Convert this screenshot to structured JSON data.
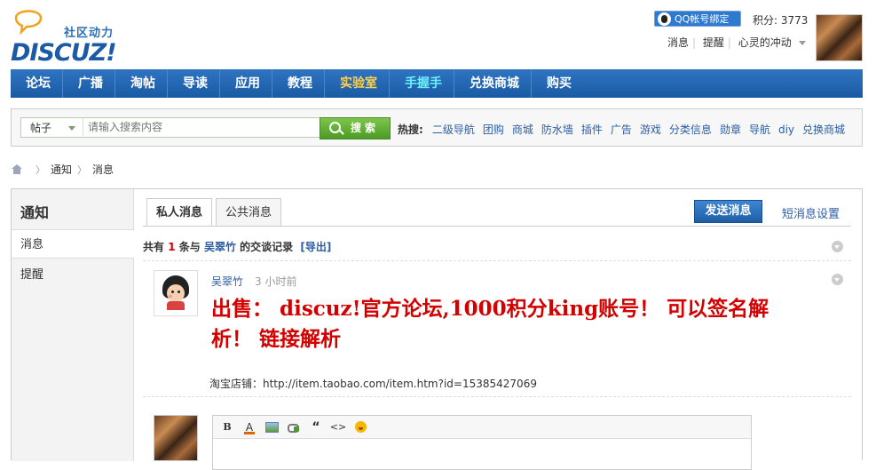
{
  "header": {
    "logo_slogan": "社区动力",
    "logo_word": "DISCUZ!",
    "qq_bind_label": "QQ帐号绑定",
    "score_label": "积分: 3773",
    "user_links": [
      "消息",
      "提醒",
      "心灵的冲动"
    ]
  },
  "nav": {
    "items": [
      {
        "label": "论坛",
        "color": "#ffffff"
      },
      {
        "label": "广播",
        "color": "#ffffff"
      },
      {
        "label": "淘帖",
        "color": "#ffffff"
      },
      {
        "label": "导读",
        "color": "#ffffff"
      },
      {
        "label": "应用",
        "color": "#ffffff"
      },
      {
        "label": "教程",
        "color": "#ffffff"
      },
      {
        "label": "实验室",
        "color": "#ffd24a"
      },
      {
        "label": "手握手",
        "color": "#6ef0ff"
      },
      {
        "label": "兑换商城",
        "color": "#ffffff"
      },
      {
        "label": "购买",
        "color": "#ffffff"
      }
    ]
  },
  "search": {
    "type_label": "帖子",
    "placeholder": "请输入搜索内容",
    "button_label": "搜索",
    "hot_label": "热搜:",
    "hot_terms": [
      "二级导航",
      "团购",
      "商城",
      "防水墙",
      "插件",
      "广告",
      "游戏",
      "分类信息",
      "勋章",
      "导航",
      "diy",
      "兑换商城"
    ]
  },
  "breadcrumb": {
    "items": [
      "通知",
      "消息"
    ]
  },
  "sidebar": {
    "title": "通知",
    "items": [
      "消息",
      "提醒"
    ]
  },
  "tabs": {
    "items": [
      "私人消息",
      "公共消息"
    ]
  },
  "actions": {
    "send_label": "发送消息",
    "settings_label": "短消息设置"
  },
  "summary": {
    "prefix": "共有",
    "count": "1",
    "mid": "条与",
    "user": "吴翠竹",
    "suffix": "的交谈记录",
    "export": "[导出]"
  },
  "message": {
    "author": "吴翠竹",
    "time": "3 小时前",
    "body": "出售： discuz!官方论坛,1000积分king账号！ 可以签名解析！ 链接解析",
    "shop": "淘宝店铺：http://item.taobao.com/item.htm?id=15385427069"
  },
  "editor": {
    "toolbar": [
      "bold-icon",
      "font-color-icon",
      "image-icon",
      "link-icon",
      "quote-icon",
      "code-icon",
      "smiley-icon"
    ],
    "bold_glyph": "B",
    "color_glyph": "A",
    "quote_glyph": "“",
    "code_glyph": "<>"
  },
  "colors": {
    "nav_bg": "#1a5aa3",
    "link": "#2b5ea3",
    "highlight_red": "#d40000",
    "search_green": "#5aa92d"
  }
}
